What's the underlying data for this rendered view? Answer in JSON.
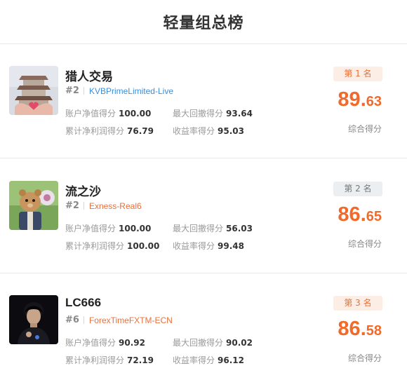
{
  "header": {
    "title": "轻量组总榜"
  },
  "entries": [
    {
      "name": "猎人交易",
      "rank": "#2",
      "account": "KVBPrimeLimited-Live",
      "account_color": "#3a8fd8",
      "badge": "第 1 名",
      "score_int": "89",
      "score_dot": ".",
      "score_dec": "63",
      "score_label": "综合得分",
      "stats": [
        {
          "label": "账户净值得分",
          "value": "100.00"
        },
        {
          "label": "最大回撤得分",
          "value": "93.64"
        },
        {
          "label": "累计净利润得分",
          "value": "76.79"
        },
        {
          "label": "收益率得分",
          "value": "95.03"
        }
      ]
    },
    {
      "name": "流之沙",
      "rank": "#2",
      "account": "Exness-Real6",
      "account_color": "#e8703b",
      "badge": "第 2 名",
      "score_int": "86",
      "score_dot": ".",
      "score_dec": "65",
      "score_label": "综合得分",
      "stats": [
        {
          "label": "账户净值得分",
          "value": "100.00"
        },
        {
          "label": "最大回撤得分",
          "value": "56.03"
        },
        {
          "label": "累计净利润得分",
          "value": "100.00"
        },
        {
          "label": "收益率得分",
          "value": "99.48"
        }
      ]
    },
    {
      "name": "LC666",
      "rank": "#6",
      "account": "ForexTimeFXTM-ECN",
      "account_color": "#e8703b",
      "badge": "第 3 名",
      "score_int": "86",
      "score_dot": ".",
      "score_dec": "58",
      "score_label": "综合得分",
      "stats": [
        {
          "label": "账户净值得分",
          "value": "90.92"
        },
        {
          "label": "最大回撤得分",
          "value": "90.02"
        },
        {
          "label": "累计净利润得分",
          "value": "72.19"
        },
        {
          "label": "收益率得分",
          "value": "96.12"
        }
      ]
    }
  ]
}
